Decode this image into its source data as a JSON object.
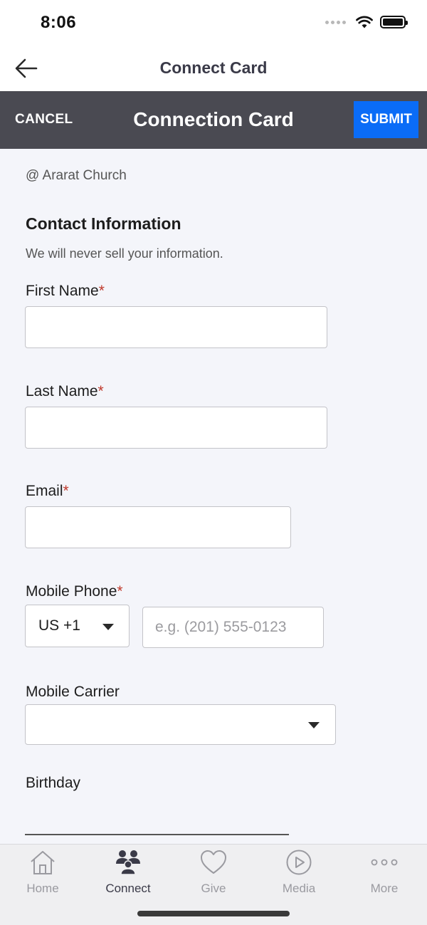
{
  "status_bar": {
    "time": "8:06"
  },
  "nav": {
    "title": "Connect Card",
    "back_icon": "arrow-left-icon"
  },
  "action_bar": {
    "cancel_label": "CANCEL",
    "title": "Connection Card",
    "submit_label": "SUBMIT",
    "submit_color": "#0a6cf7"
  },
  "form": {
    "org": "@ Ararat Church",
    "section_title": "Contact Information",
    "section_subtitle": "We will never sell your information.",
    "required_mark": "*",
    "first_name": {
      "label": "First Name",
      "value": ""
    },
    "last_name": {
      "label": "Last Name",
      "value": ""
    },
    "email": {
      "label": "Email",
      "value": ""
    },
    "mobile_phone": {
      "label": "Mobile Phone",
      "country_code": "US +1",
      "placeholder": "e.g. (201) 555-0123",
      "value": ""
    },
    "mobile_carrier": {
      "label": "Mobile Carrier",
      "value": ""
    },
    "birthday": {
      "label": "Birthday"
    }
  },
  "tabs": [
    {
      "label": "Home",
      "icon": "home-icon",
      "active": false
    },
    {
      "label": "Connect",
      "icon": "people-icon",
      "active": true
    },
    {
      "label": "Give",
      "icon": "heart-icon",
      "active": false
    },
    {
      "label": "Media",
      "icon": "play-circle-icon",
      "active": false
    },
    {
      "label": "More",
      "icon": "more-dots-icon",
      "active": false
    }
  ]
}
